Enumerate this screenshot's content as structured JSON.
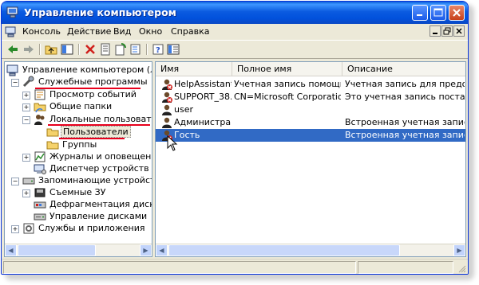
{
  "window": {
    "title": "Управление компьютером"
  },
  "menu": [
    "Консоль",
    "Действие",
    "Вид",
    "Окно",
    "Справка"
  ],
  "tree": {
    "root": "Управление компьютером (локаль",
    "system_tools": "Служебные программы",
    "event_viewer": "Просмотр событий",
    "shared_folders": "Общие папки",
    "local_users": "Локальные пользователи",
    "users": "Пользователи",
    "groups": "Группы",
    "perf_logs": "Журналы и оповещения пр",
    "device_manager": "Диспетчер устройств",
    "storage": "Запоминающие устройства",
    "removable": "Съемные ЗУ",
    "defrag": "Дефрагментация диска",
    "disk_mgmt": "Управление дисками",
    "services": "Службы и приложения"
  },
  "list": {
    "columns": [
      "Имя",
      "Полное имя",
      "Описание"
    ],
    "rows": [
      {
        "name": "HelpAssistant",
        "fullname": "Учетная запись помощн...",
        "desc": "Учетная запись для предоставле",
        "disabled": true
      },
      {
        "name": "SUPPORT_38...",
        "fullname": "CN=Microsoft Corporation...",
        "desc": "Это учетная запись поставщика",
        "disabled": true
      },
      {
        "name": "user",
        "fullname": "",
        "desc": "",
        "disabled": false
      },
      {
        "name": "Администра...",
        "fullname": "",
        "desc": "Встроенная учетная запись адми",
        "disabled": false
      },
      {
        "name": "Гость",
        "fullname": "",
        "desc": "Встроенная учетная запись для ",
        "disabled": true,
        "selected": true
      }
    ]
  },
  "colors": {
    "highlight": "#316ac5",
    "underline": "#e8001c",
    "titlebar": "#0151dc"
  }
}
